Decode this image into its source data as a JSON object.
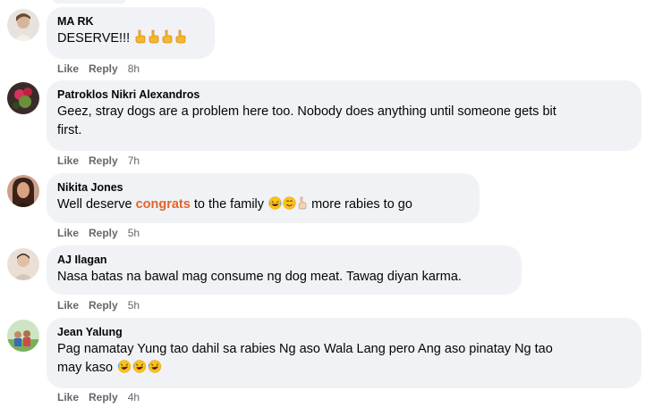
{
  "comments": [
    {
      "author": "MA RK",
      "text": "DESERVE!!!",
      "emojis": [
        "pointing-hand",
        "pointing-hand",
        "pointing-hand",
        "pointing-hand"
      ],
      "like": "Like",
      "reply": "Reply",
      "time": "8h"
    },
    {
      "author": "Patroklos Nikri Alexandros",
      "line1": "Geez, stray dogs are a problem here too. Nobody does anything until someone gets bit",
      "line2": "first.",
      "like": "Like",
      "reply": "Reply",
      "time": "7h"
    },
    {
      "author": "Nikita Jones",
      "text_before": "Well deserve",
      "highlight": "congrats",
      "text_mid": "to the family",
      "emojis": [
        "laughing-face",
        "grinning-face",
        "hand-icon"
      ],
      "text_after": "more rabies to go",
      "like": "Like",
      "reply": "Reply",
      "time": "5h"
    },
    {
      "author": "AJ Ilagan",
      "text": "Nasa batas na bawal mag consume ng dog meat. Tawag diyan karma.",
      "like": "Like",
      "reply": "Reply",
      "time": "5h"
    },
    {
      "author": "Jean Yalung",
      "line1": "Pag namatay Yung tao dahil sa rabies Ng aso Wala Lang pero Ang aso pinatay Ng tao",
      "line2": "may kaso",
      "emojis": [
        "rofl-face",
        "rofl-face",
        "rofl-face"
      ],
      "like": "Like",
      "reply": "Reply",
      "time": "4h"
    }
  ],
  "colors": {
    "bubble": "#f0f2f5",
    "meta": "#65676b",
    "highlight": "#e4632b"
  }
}
